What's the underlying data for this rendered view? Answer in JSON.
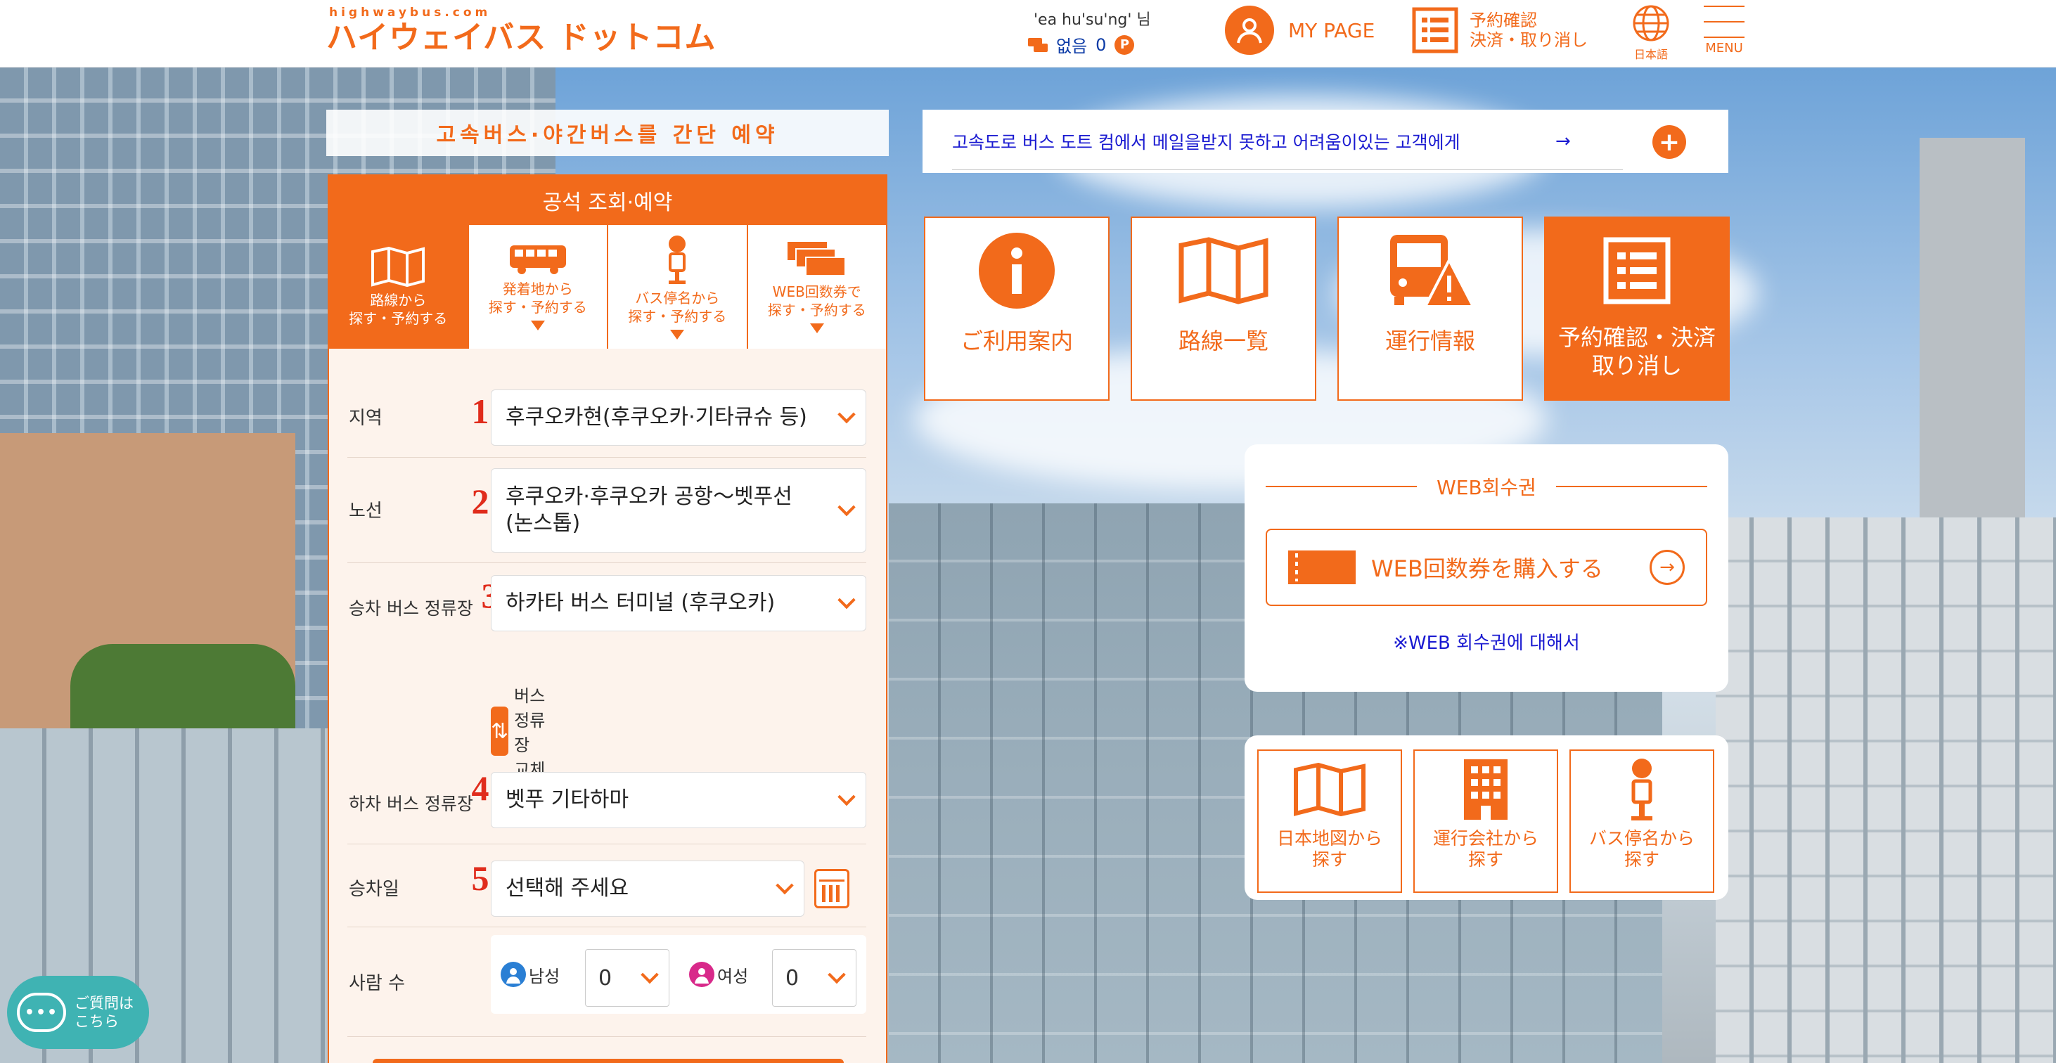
{
  "header": {
    "logo_small": "highwaybus.com",
    "logo_main": "ハイウェイバス ドットコム",
    "user_name": "'ea hu'su'ng' 님",
    "points_label": "없음",
    "points_value": "0",
    "points_badge": "P",
    "mypage_label": "MY PAGE",
    "reservation_line1": "予約確認",
    "reservation_line2": "決済・取り消し",
    "language_label": "日本語",
    "menu_label": "MENU"
  },
  "panel": {
    "title": "고속버스·야간버스를 간단 예약",
    "head": "공석 조회·예약",
    "tabs": [
      {
        "line1": "路線から",
        "line2": "探す・予約する"
      },
      {
        "line1": "発着地から",
        "line2": "探す・予約する"
      },
      {
        "line1": "バス停名から",
        "line2": "探す・予約する"
      },
      {
        "line1": "WEB回数券で",
        "line2": "探す・予約する"
      }
    ],
    "fields": {
      "region": {
        "label": "지역",
        "num": "1",
        "value": "후쿠오카현(후쿠오카·기타큐슈 등)"
      },
      "route": {
        "label": "노선",
        "num": "2",
        "value_line1": "후쿠오카·후쿠오카 공항～벳푸선",
        "value_line2": "(논스톱)"
      },
      "boarding": {
        "label": "승차 버스 정류장",
        "num": "3",
        "value": "하카타 버스 터미널 (후쿠오카)"
      },
      "swap_label": "버스 정류장 교체",
      "alighting": {
        "label": "하차 버스 정류장",
        "num": "4",
        "value": "벳푸 기타하마"
      },
      "date": {
        "label": "승차일",
        "num": "5",
        "value": "선택해 주세요"
      },
      "people": {
        "label": "사람 수",
        "male_label": "남성",
        "male_value": "0",
        "female_label": "여성",
        "female_value": "0"
      }
    }
  },
  "notice": {
    "text": "고속도로 버스 도트 컴에서 메일을받지 못하고 어려움이있는 고객에게",
    "arrow": "→",
    "plus": "+"
  },
  "tiles": [
    {
      "label": "ご利用案内",
      "icon": "info-icon"
    },
    {
      "label": "路線一覧",
      "icon": "map-icon"
    },
    {
      "label": "運行情報",
      "icon": "bus-warning-icon"
    },
    {
      "label_line1": "予約確認・決済",
      "label_line2": "取り消し",
      "icon": "list-icon"
    }
  ],
  "web_ticket": {
    "title": "WEB회수권",
    "button_label": "WEB回数券を購入する",
    "link": "※WEB 회수권에 대해서"
  },
  "search_tiles": [
    {
      "line1": "日本地図から",
      "line2": "探す",
      "icon": "map-icon"
    },
    {
      "line1": "運行会社から",
      "line2": "探す",
      "icon": "building-icon"
    },
    {
      "line1": "バス停名から",
      "line2": "探す",
      "icon": "bus-stop-icon"
    }
  ],
  "chat": {
    "line1": "ご質問は",
    "line2": "こちら",
    "bubble": "•••"
  },
  "colors": {
    "accent": "#f26a1b",
    "link": "#1a1ad1",
    "number": "#e02c1c",
    "chat": "#3fb3b3"
  }
}
